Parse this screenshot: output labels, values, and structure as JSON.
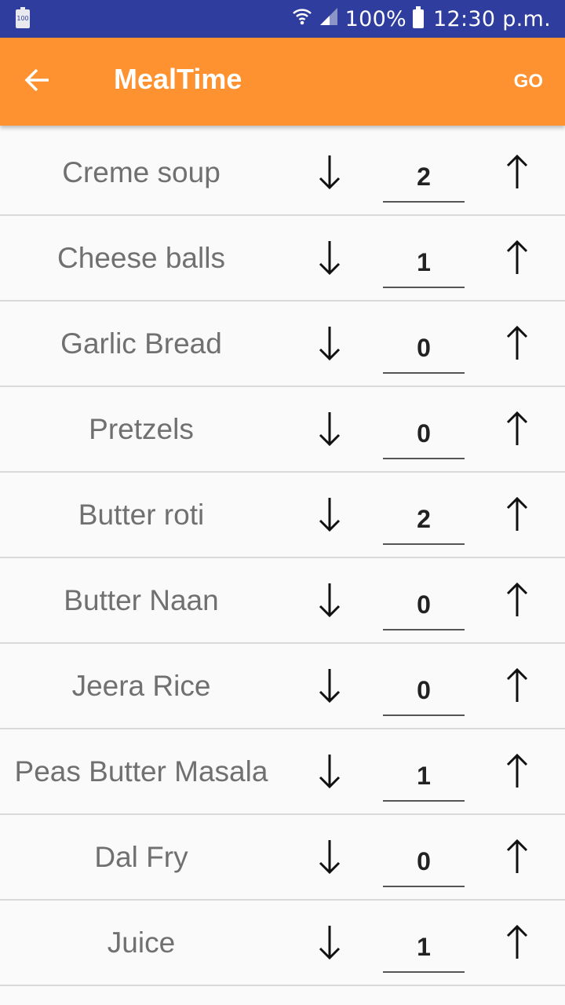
{
  "status_bar": {
    "notification_icon_text": "100",
    "battery_percent": "100%",
    "time": "12:30 p.m.",
    "icons": [
      "battery-notification-icon",
      "wifi-icon",
      "signal-icon",
      "battery-icon"
    ]
  },
  "app_bar": {
    "title": "MealTime",
    "go_label": "GO",
    "background_color": "#ff9230"
  },
  "items": [
    {
      "name": "Creme soup",
      "qty": "2"
    },
    {
      "name": "Cheese balls",
      "qty": "1"
    },
    {
      "name": "Garlic Bread",
      "qty": "0"
    },
    {
      "name": "Pretzels",
      "qty": "0"
    },
    {
      "name": "Butter roti",
      "qty": "2"
    },
    {
      "name": "Butter Naan",
      "qty": "0"
    },
    {
      "name": "Jeera Rice",
      "qty": "0"
    },
    {
      "name": "Peas Butter Masala",
      "qty": "1"
    },
    {
      "name": "Dal Fry",
      "qty": "0"
    },
    {
      "name": "Juice",
      "qty": "1"
    }
  ]
}
